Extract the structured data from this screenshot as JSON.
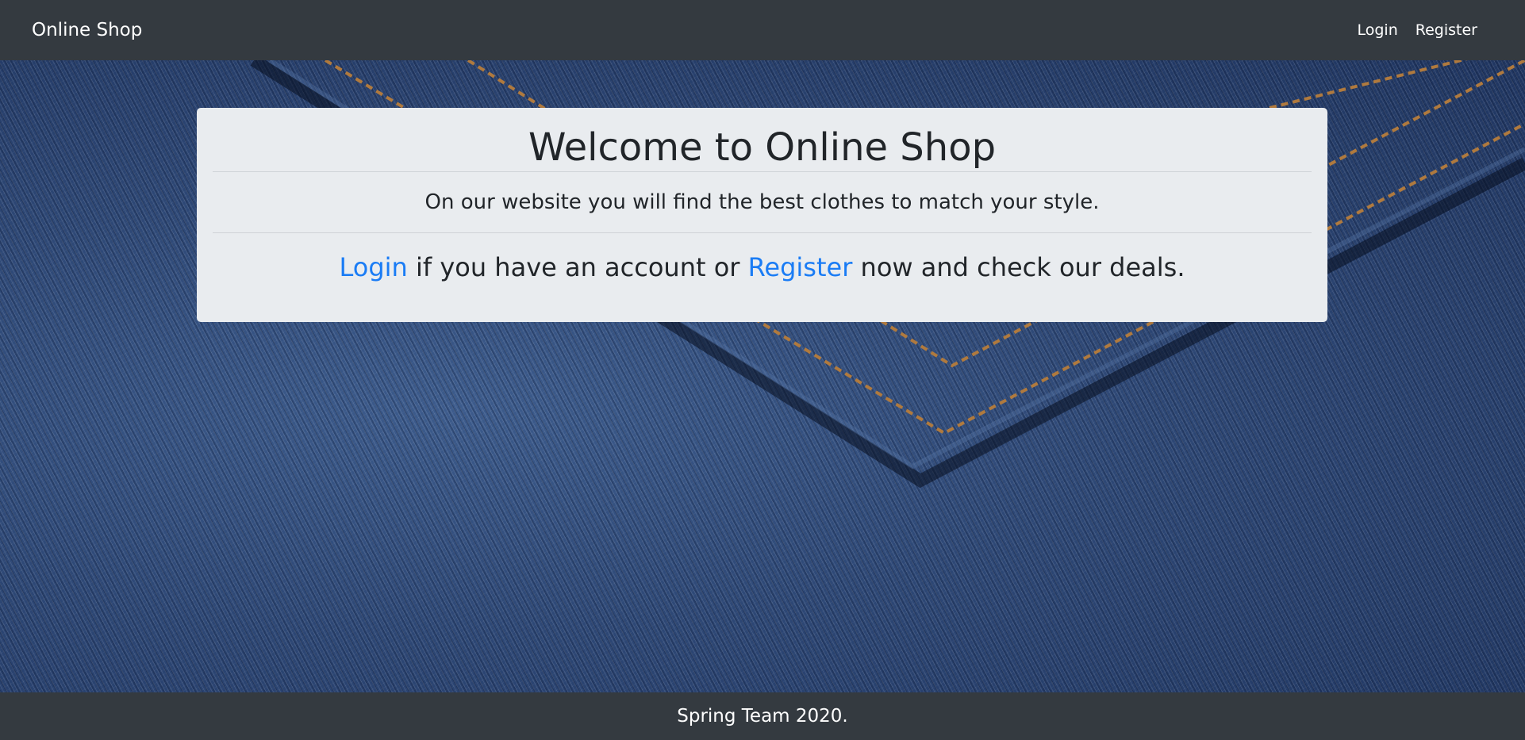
{
  "navbar": {
    "brand": "Online Shop",
    "login_label": "Login",
    "register_label": "Register"
  },
  "jumbotron": {
    "title": "Welcome to Online Shop",
    "tagline": "On our website you will find the best clothes to match your style.",
    "cta": {
      "login_link": "Login",
      "text_middle": " if you have an account or ",
      "register_link": "Register",
      "text_end": " now and check our deals."
    }
  },
  "footer": {
    "text": "Spring Team 2020."
  },
  "colors": {
    "navbar_bg": "#343a40",
    "jumbotron_bg": "#e9ecef",
    "link": "#1a7cf5",
    "text": "#212529"
  },
  "background": {
    "image": "denim-pocket-background"
  }
}
